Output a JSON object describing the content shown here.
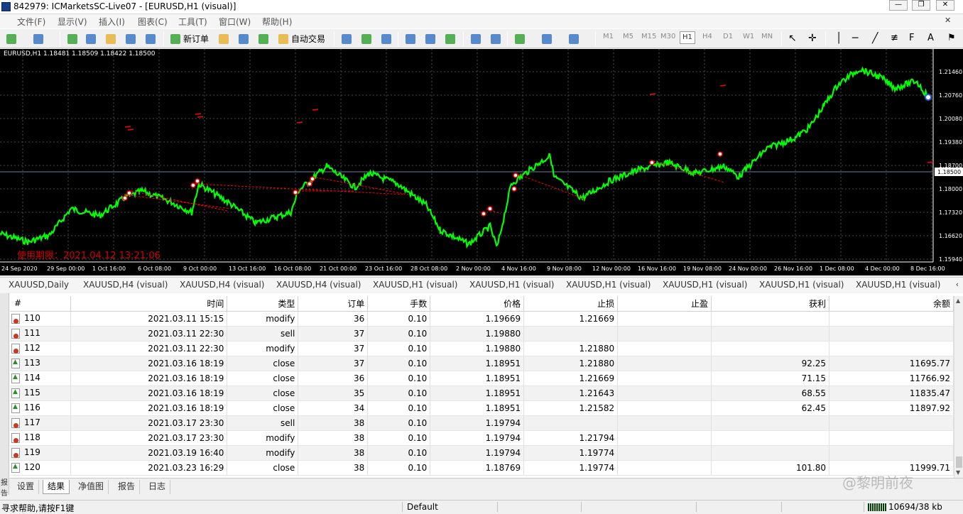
{
  "window": {
    "title": "842979: ICMarketsSC-Live07 - [EURUSD,H1 (visual)]",
    "minimize": "—",
    "restore": "❐",
    "close": "✕"
  },
  "menu": [
    "文件(F)",
    "显示(V)",
    "插入(I)",
    "图表(C)",
    "工具(T)",
    "窗口(W)",
    "帮助(H)"
  ],
  "toolbar": {
    "new_order": "新订单",
    "auto_trade": "自动交易",
    "timeframes": [
      "M1",
      "M5",
      "M15",
      "M30",
      "H1",
      "H4",
      "D1",
      "W1",
      "MN"
    ],
    "active_timeframe": "H1"
  },
  "chart": {
    "info": "EURUSD,H1  1.18481  1.18509  1.18422  1.18500",
    "expiry_text": "使用期限：2021.04.12 13:21:06",
    "current_price": "1.18500",
    "colors": {
      "background": "#000000",
      "candles": "#00ff00",
      "grid": "#4a4a4a",
      "price_line": "#6a7fa8",
      "orders": "#ff0000"
    },
    "price_labels": [
      "1.21460",
      "1.20760",
      "1.20080",
      "1.19380",
      "1.18700",
      "1.18000",
      "1.17320",
      "1.16620",
      "1.15940"
    ],
    "time_labels": [
      "24 Sep 2020",
      "29 Sep 00:00",
      "1 Oct 16:00",
      "6 Oct 08:00",
      "9 Oct 00:00",
      "13 Oct 16:00",
      "16 Oct 08:00",
      "21 Oct 00:00",
      "23 Oct 16:00",
      "28 Oct 08:00",
      "2 Nov 00:00",
      "4 Nov 16:00",
      "9 Nov 08:00",
      "12 Nov 00:00",
      "16 Nov 16:00",
      "19 Nov 08:00",
      "24 Nov 00:00",
      "26 Nov 16:00",
      "1 Dec 08:00",
      "4 Dec 00:00",
      "8 Dec 16:00"
    ]
  },
  "chart_tabs": [
    "XAUUSD,Daily",
    "XAUUSD,H4 (visual)",
    "XAUUSD,H4 (visual)",
    "XAUUSD,H4 (visual)",
    "XAUUSD,H1 (visual)",
    "XAUUSD,H1 (visual)",
    "XAUUSD,H1 (visual)",
    "XAUUSD,H1 (visual)",
    "XAUUSD,H1 (visual)",
    "XAUUSD,H1 (visual)"
  ],
  "results": {
    "side_label": "报告",
    "columns": [
      "#",
      "时间",
      "类型",
      "订单",
      "手数",
      "价格",
      "止损",
      "止盈",
      "获利",
      "余额"
    ],
    "rows": [
      {
        "n": "110",
        "time": "2021.03.11 15:15",
        "type": "modify",
        "order": "36",
        "lots": "0.10",
        "price": "1.19669",
        "sl": "1.21669",
        "tp": "",
        "profit": "",
        "balance": "",
        "icon": "pending"
      },
      {
        "n": "111",
        "time": "2021.03.11 22:30",
        "type": "sell",
        "order": "37",
        "lots": "0.10",
        "price": "1.19880",
        "sl": "",
        "tp": "",
        "profit": "",
        "balance": "",
        "icon": "pending"
      },
      {
        "n": "112",
        "time": "2021.03.11 22:30",
        "type": "modify",
        "order": "37",
        "lots": "0.10",
        "price": "1.19880",
        "sl": "1.21880",
        "tp": "",
        "profit": "",
        "balance": "",
        "icon": "pending"
      },
      {
        "n": "113",
        "time": "2021.03.16 18:19",
        "type": "close",
        "order": "37",
        "lots": "0.10",
        "price": "1.18951",
        "sl": "1.21880",
        "tp": "",
        "profit": "92.25",
        "balance": "11695.77",
        "icon": "closed"
      },
      {
        "n": "114",
        "time": "2021.03.16 18:19",
        "type": "close",
        "order": "36",
        "lots": "0.10",
        "price": "1.18951",
        "sl": "1.21669",
        "tp": "",
        "profit": "71.15",
        "balance": "11766.92",
        "icon": "closed"
      },
      {
        "n": "115",
        "time": "2021.03.16 18:19",
        "type": "close",
        "order": "35",
        "lots": "0.10",
        "price": "1.18951",
        "sl": "1.21643",
        "tp": "",
        "profit": "68.55",
        "balance": "11835.47",
        "icon": "closed"
      },
      {
        "n": "116",
        "time": "2021.03.16 18:19",
        "type": "close",
        "order": "34",
        "lots": "0.10",
        "price": "1.18951",
        "sl": "1.21582",
        "tp": "",
        "profit": "62.45",
        "balance": "11897.92",
        "icon": "closed"
      },
      {
        "n": "117",
        "time": "2021.03.17 23:30",
        "type": "sell",
        "order": "38",
        "lots": "0.10",
        "price": "1.19794",
        "sl": "",
        "tp": "",
        "profit": "",
        "balance": "",
        "icon": "pending"
      },
      {
        "n": "118",
        "time": "2021.03.17 23:30",
        "type": "modify",
        "order": "38",
        "lots": "0.10",
        "price": "1.19794",
        "sl": "1.21794",
        "tp": "",
        "profit": "",
        "balance": "",
        "icon": "pending"
      },
      {
        "n": "119",
        "time": "2021.03.19 16:40",
        "type": "modify",
        "order": "38",
        "lots": "0.10",
        "price": "1.19794",
        "sl": "1.19774",
        "tp": "",
        "profit": "",
        "balance": "",
        "icon": "pending"
      },
      {
        "n": "120",
        "time": "2021.03.23 16:29",
        "type": "close",
        "order": "38",
        "lots": "0.10",
        "price": "1.18769",
        "sl": "1.19774",
        "tp": "",
        "profit": "101.80",
        "balance": "11999.71",
        "icon": "closed"
      }
    ]
  },
  "bottom_tabs": [
    "设置",
    "结果",
    "净值图",
    "报告",
    "日志"
  ],
  "active_bottom_tab": "结果",
  "watermark": "@黎明前夜",
  "status": {
    "help": "寻求帮助,请按F1键",
    "profile": "Default",
    "traffic": "10694/38 kb"
  }
}
